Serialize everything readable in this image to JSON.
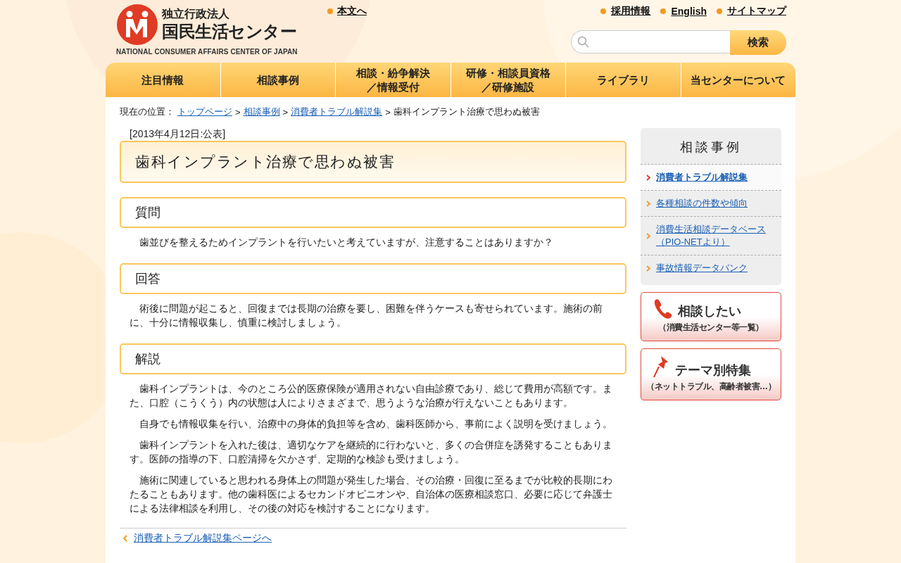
{
  "header": {
    "logo_small": "独立行政法人",
    "logo_main": "国民生活センター",
    "logo_english": "NATIONAL CONSUMER AFFAIRS CENTER OF JAPAN",
    "skip_link": "本文へ",
    "top_links": [
      "採用情報",
      "English",
      "サイトマップ"
    ],
    "search": {
      "button": "検索"
    }
  },
  "nav": [
    {
      "lines": [
        "注目情報"
      ]
    },
    {
      "lines": [
        "相談事例"
      ]
    },
    {
      "lines": [
        "相談・紛争解決",
        "／情報受付"
      ]
    },
    {
      "lines": [
        "研修・相談員資格",
        "／研修施設"
      ]
    },
    {
      "lines": [
        "ライブラリ"
      ]
    },
    {
      "lines": [
        "当センターについて"
      ]
    }
  ],
  "breadcrumb": {
    "label": "現在の位置：",
    "separator": ">",
    "links": [
      "トップページ",
      "相談事例",
      "消費者トラブル解説集"
    ],
    "current": "歯科インプラント治療で思わぬ被害"
  },
  "article": {
    "date": "[2013年4月12日:公表]",
    "title": "歯科インプラント治療で思わぬ被害",
    "sections": [
      {
        "heading": "質問",
        "paragraphs": [
          "歯並びを整えるためインプラントを行いたいと考えていますが、注意することはありますか？"
        ]
      },
      {
        "heading": "回答",
        "paragraphs": [
          "術後に問題が起こると、回復までは長期の治療を要し、困難を伴うケースも寄せられています。施術の前に、十分に情報収集し、慎重に検討しましょう。"
        ]
      },
      {
        "heading": "解説",
        "paragraphs": [
          "歯科インプラントは、今のところ公的医療保険が適用されない自由診療であり、総じて費用が高額です。また、口腔（こうくう）内の状態は人によりさまざまで、思うような治療が行えないこともあります。",
          "自身でも情報収集を行い、治療中の身体的負担等を含め、歯科医師から、事前によく説明を受けましょう。",
          "歯科インプラントを入れた後は、適切なケアを継続的に行わないと、多くの合併症を誘発することもあります。医師の指導の下、口腔清掃を欠かさず、定期的な検診も受けましょう。",
          "施術に関連していると思われる身体上の問題が発生した場合、その治療・回復に至るまでが比較的長期にわたることもあります。他の歯科医によるセカンドオピニオンや、自治体の医療相談窓口、必要に応じて弁護士による法律相談を利用し、その後の対応を検討することになります。"
        ]
      }
    ],
    "back_link": "消費者トラブル解説集ページへ"
  },
  "sidebar": {
    "title": "相談事例",
    "items": [
      {
        "label": "消費者トラブル解説集",
        "selected": true
      },
      {
        "label": "各種相談の件数や傾向",
        "selected": false
      },
      {
        "label": "消費生活相談データベース（PIO-NETより）",
        "selected": false
      },
      {
        "label": "事故情報データバンク",
        "selected": false
      }
    ],
    "banners": [
      {
        "kind": "phone",
        "title": "相談したい",
        "subtitle": "（消費生活センター等一覧）"
      },
      {
        "kind": "pin",
        "title": "テーマ別特集",
        "subtitle": "（ネットトラブル、高齢者被害…）"
      }
    ]
  }
}
